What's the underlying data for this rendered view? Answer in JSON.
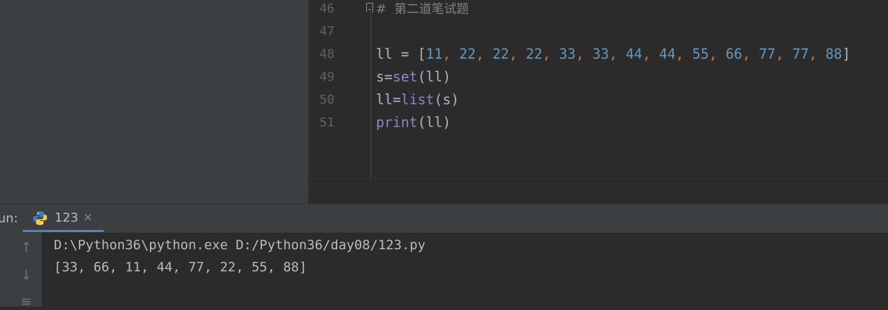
{
  "editor": {
    "line_numbers": [
      "46",
      "47",
      "48",
      "49",
      "50",
      "51"
    ],
    "comment": "第二道笔试题",
    "line48": {
      "var": "ll",
      "op": "=",
      "values": [
        "11",
        "22",
        "22",
        "22",
        "33",
        "33",
        "44",
        "44",
        "55",
        "66",
        "77",
        "77",
        "88"
      ]
    },
    "line49": {
      "lhs": "s=",
      "fn": "set",
      "arg": "(ll)"
    },
    "line50": {
      "lhs": "ll=",
      "fn": "list",
      "arg": "(s)"
    },
    "line51": {
      "fn": "print",
      "arg": "(ll)"
    }
  },
  "run_panel": {
    "label": "un:",
    "tab_label": "123",
    "close_glyph": "×",
    "console_lines": [
      "D:\\Python36\\python.exe D:/Python36/day08/123.py",
      "[33, 66, 11, 44, 77, 22, 55, 88]"
    ]
  },
  "icons": {
    "up": "↑",
    "down": "↓",
    "wrap": "≡"
  },
  "colors": {
    "editor_bg": "#2b2b2b",
    "panel_bg": "#3c3f41",
    "number": "#6897bb",
    "keyword_punct": "#cc7832",
    "builtin": "#8888c6",
    "comment": "#808080",
    "tab_accent": "#4a88c7"
  }
}
